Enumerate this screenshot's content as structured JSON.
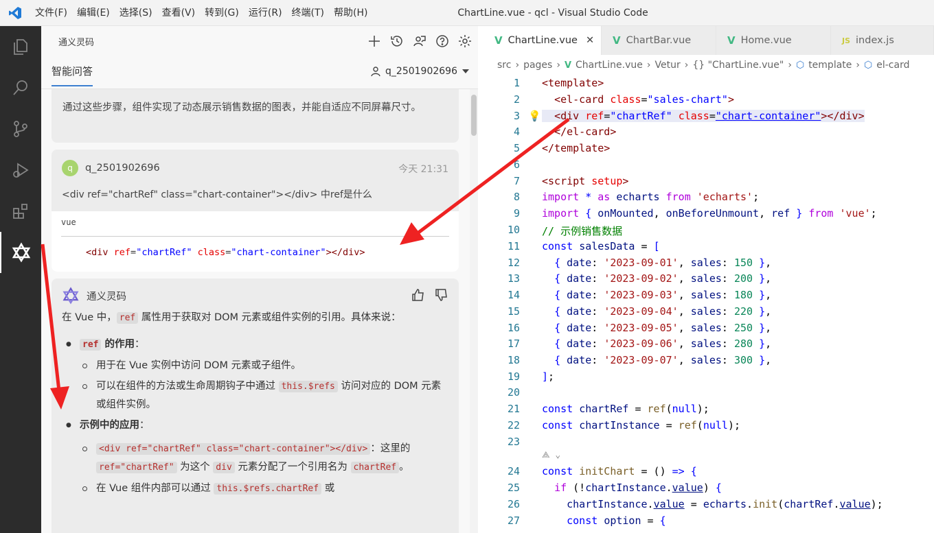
{
  "menu": [
    "文件(F)",
    "编辑(E)",
    "选择(S)",
    "查看(V)",
    "转到(G)",
    "运行(R)",
    "终端(T)",
    "帮助(H)"
  ],
  "window_title": "ChartLine.vue - qcl - Visual Studio Code",
  "panel": {
    "title": "通义灵码",
    "tab": "智能问答",
    "user": "q_2501902696"
  },
  "chat": {
    "prev_answer": "通过这些步骤，组件实现了动态展示销售数据的图表，并能自适应不同屏幕尺寸。",
    "user_name": "q_2501902696",
    "user_avatar": "q",
    "user_time": "今天 21:31",
    "user_msg": "<div ref=\"chartRef\" class=\"chart-container\"></div> 中ref是什么",
    "code_lang": "vue",
    "ai_name": "通义灵码",
    "ans_intro_1": "在 Vue 中，",
    "ans_ref": "ref",
    "ans_intro_2": " 属性用于获取对 DOM 元素或组件实例的引用。具体来说：",
    "b1_code": "ref",
    "b1_title": " 的作用",
    "b1_colon": "：",
    "b1_s1": "用于在 Vue 实例中访问 DOM 元素或子组件。",
    "b1_s2_a": "可以在组件的方法或生命周期钩子中通过 ",
    "b1_s2_code": "this.$refs",
    "b1_s2_b": " 访问对应的 DOM 元素或组件实例。",
    "b2_title": "示例中的应用",
    "b2_colon": "：",
    "b2_s1_code": "<div ref=\"chartRef\" class=\"chart-container\"></div>",
    "b2_s1_a": "：这里的 ",
    "b2_s1_code2": "ref=\"chartRef\"",
    "b2_s1_b": " 为这个 ",
    "b2_s1_code3": "div",
    "b2_s1_c": " 元素分配了一个引用名为 ",
    "b2_s1_code4": "chartRef",
    "b2_s1_d": "。",
    "b2_s2_a": "在 Vue 组件内部可以通过 ",
    "b2_s2_code": "this.$refs.chartRef",
    "b2_s2_b": " 或"
  },
  "editor": {
    "tabs": [
      {
        "label": "ChartLine.vue",
        "icon": "vue",
        "active": true
      },
      {
        "label": "ChartBar.vue",
        "icon": "vue",
        "active": false
      },
      {
        "label": "Home.vue",
        "icon": "vue",
        "active": false
      },
      {
        "label": "index.js",
        "icon": "js",
        "active": false
      }
    ],
    "breadcrumbs": [
      "src",
      "pages",
      "ChartLine.vue",
      "Vetur",
      "{} \"ChartLine.vue\"",
      "template",
      "el-card"
    ],
    "line_numbers": [
      "1",
      "2",
      "3",
      "4",
      "5",
      "6",
      "7",
      "8",
      "9",
      "10",
      "11",
      "12",
      "13",
      "14",
      "15",
      "16",
      "17",
      "18",
      "19",
      "20",
      "21",
      "22",
      "23",
      "24",
      "25",
      "26",
      "27"
    ]
  },
  "colors": {
    "accent": "#3c7fd0",
    "activity_bar": "#2c2c2c",
    "arrow": "#ee2222"
  }
}
